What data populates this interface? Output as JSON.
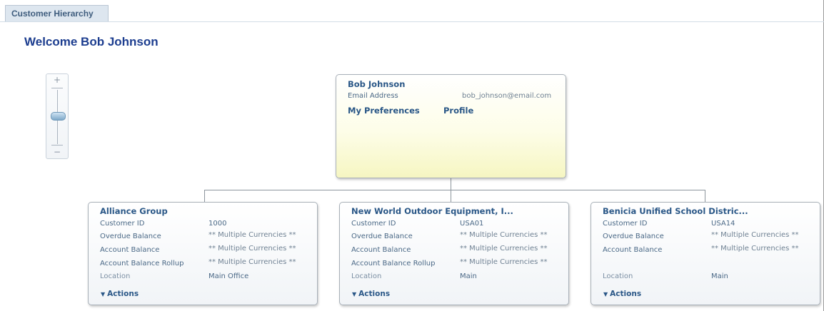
{
  "tab": {
    "label": "Customer Hierarchy"
  },
  "welcome": "Welcome Bob Johnson",
  "zoom": {
    "plus": "+",
    "minus": "−"
  },
  "root": {
    "name": "Bob Johnson",
    "email_label": "Email Address",
    "email_value": "bob_johnson@email.com",
    "preferences_link": "My Preferences",
    "profile_link": "Profile"
  },
  "customers": [
    {
      "name": "Alliance Group",
      "customer_id_label": "Customer ID",
      "customer_id": "1000",
      "overdue_label": "Overdue Balance",
      "overdue": "** Multiple Currencies **",
      "account_label": "Account Balance",
      "account": "** Multiple Currencies **",
      "rollup_label": "Account Balance Rollup",
      "rollup": "** Multiple Currencies **",
      "location_label": "Location",
      "location": "Main Office",
      "actions": "Actions"
    },
    {
      "name": "New World Outdoor Equipment, I...",
      "customer_id_label": "Customer ID",
      "customer_id": "USA01",
      "overdue_label": "Overdue Balance",
      "overdue": "** Multiple Currencies **",
      "account_label": "Account Balance",
      "account": "** Multiple Currencies **",
      "rollup_label": "Account Balance Rollup",
      "rollup": "** Multiple Currencies **",
      "location_label": "Location",
      "location": "Main",
      "actions": "Actions"
    },
    {
      "name": "Benicia Unified School Distric...",
      "customer_id_label": "Customer ID",
      "customer_id": "USA14",
      "overdue_label": "Overdue Balance",
      "overdue": "** Multiple Currencies **",
      "account_label": "Account Balance",
      "account": "** Multiple Currencies **",
      "location_label": "Location",
      "location": "Main",
      "actions": "Actions"
    }
  ],
  "colors": {
    "title_blue": "#1c3d8f",
    "link_blue": "#2a5787",
    "root_card_yellow": "#f6f6c2"
  }
}
